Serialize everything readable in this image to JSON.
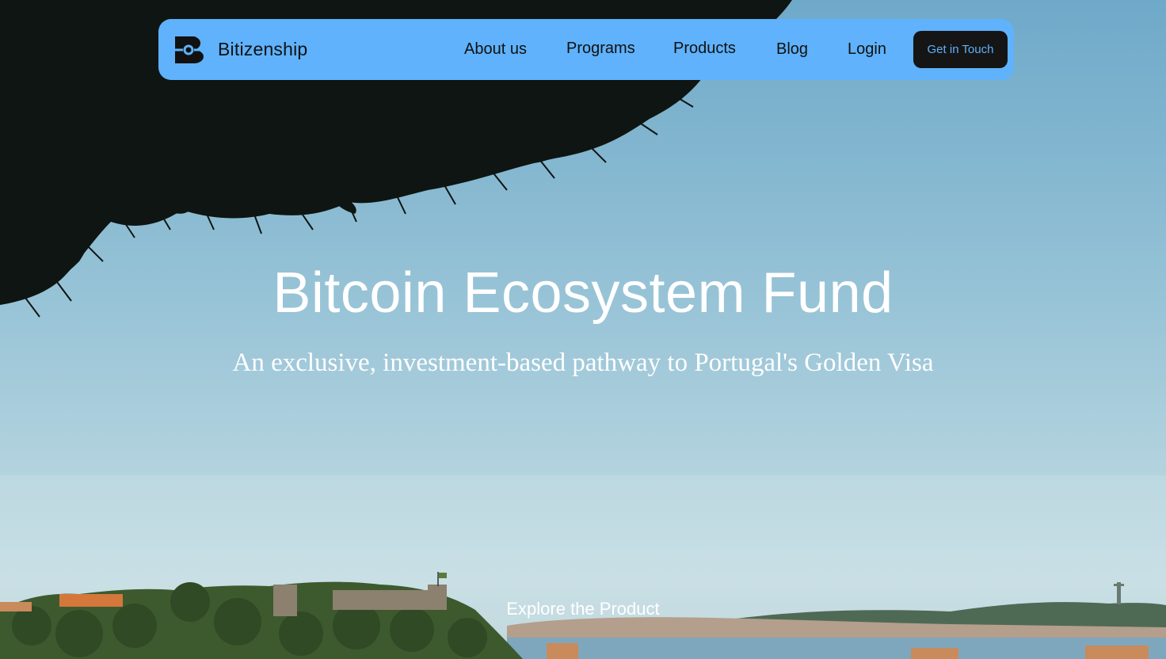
{
  "header": {
    "logo_icon": "bitizenship-logo-icon",
    "brand_name": "Bitizenship",
    "nav": {
      "about": "About us",
      "programs": "Programs",
      "products": "Products",
      "blog": "Blog",
      "login": "Login"
    },
    "cta_label": "Get in Touch"
  },
  "hero": {
    "title": "Bitcoin Ecosystem Fund",
    "subtitle": "An exclusive, investment-based pathway to Portugal's Golden Visa",
    "explore_label": "Explore the Product",
    "background_image": "lisbon-skyline-with-pine-tree"
  },
  "colors": {
    "nav_background": "#5fb2fb",
    "cta_background": "#151515",
    "cta_text": "#5fb2fb",
    "hero_text": "#ffffff"
  }
}
